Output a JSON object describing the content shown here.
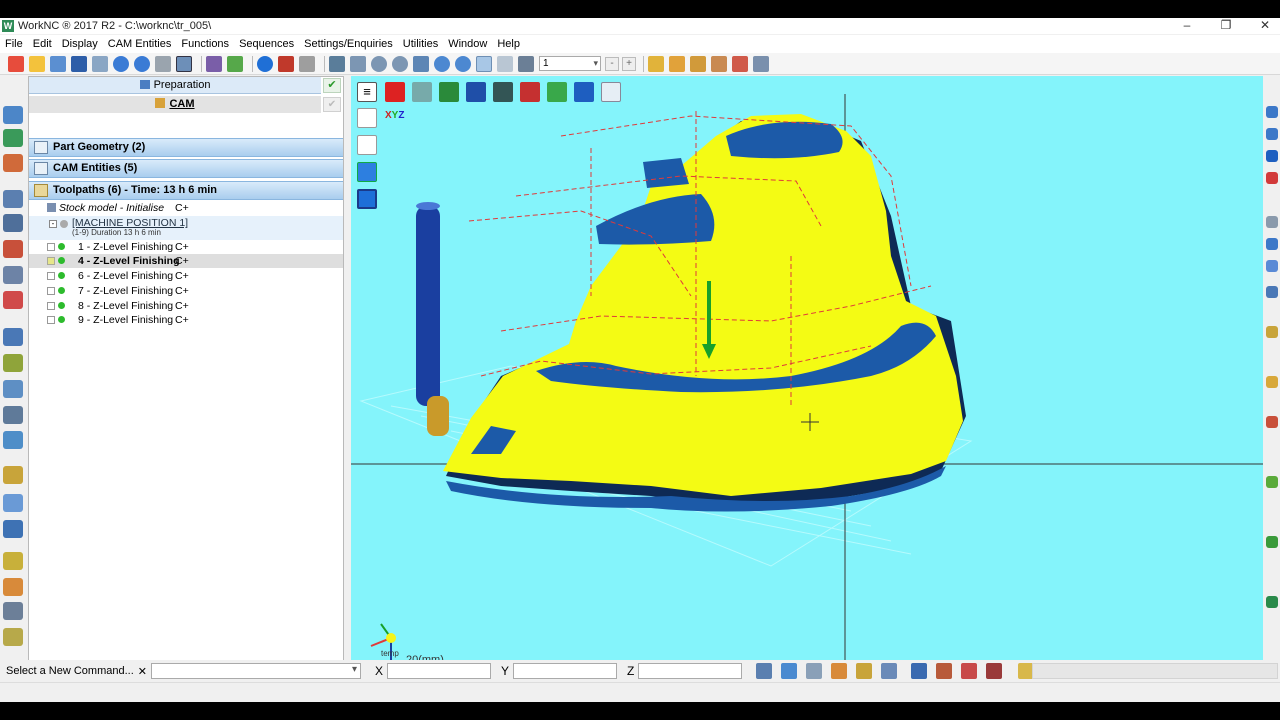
{
  "window": {
    "title": "WorkNC ® 2017 R2 - C:\\worknc\\tr_005\\",
    "logo_letter": "W",
    "minimize": "–",
    "restore": "❐",
    "close": "✕"
  },
  "menu": [
    "File",
    "Edit",
    "Display",
    "CAM Entities",
    "Functions",
    "Sequences",
    "Settings/Enquiries",
    "Utilities",
    "Window",
    "Help"
  ],
  "toolbar": {
    "level_select_value": "1",
    "minus_btn": "-",
    "plus_btn": "+"
  },
  "panel": {
    "preparation_tab": "Preparation",
    "cam_tab": "CAM",
    "check_icon": "✔",
    "sections": {
      "part_geometry": "Part Geometry (2)",
      "cam_entities": "CAM Entities (5)",
      "toolpaths": "Toolpaths (6) - Time: 13 h 6 min"
    },
    "stock_model": {
      "label": "Stock model - Initialise",
      "suffix": "C+"
    },
    "machine_position": {
      "label": "[MACHINE POSITION 1]",
      "sub": "(1-9) Duration 13 h 6 min"
    },
    "toolpaths": [
      {
        "label": "1 - Z-Level Finishing",
        "suffix": "C+",
        "checked": false,
        "selected": false
      },
      {
        "label": "4 - Z-Level Finishing",
        "suffix": "C+",
        "checked": true,
        "selected": true
      },
      {
        "label": "6 - Z-Level Finishing",
        "suffix": "C+",
        "checked": false,
        "selected": false
      },
      {
        "label": "7 - Z-Level Finishing",
        "suffix": "C+",
        "checked": false,
        "selected": false
      },
      {
        "label": "8 - Z-Level Finishing",
        "suffix": "C+",
        "checked": false,
        "selected": false
      },
      {
        "label": "9 - Z-Level Finishing",
        "suffix": "C+",
        "checked": false,
        "selected": false
      }
    ]
  },
  "viewport": {
    "background": "#84f4fb",
    "scale_label": "20(mm)",
    "axis_label": "temp",
    "axis_x": "X",
    "axis_y": "Y",
    "axis_z": "Z",
    "colors": {
      "part_yellow": "#f4fb14",
      "part_blue": "#1c5aa8",
      "tool_blue": "#1a3fa0",
      "tool_gold": "#c99a2a",
      "toolpath_red": "#e03a3a",
      "normal_green": "#18a02a"
    }
  },
  "command_bar": {
    "prompt": "Select a New Command...",
    "close": "✕",
    "x_label": "X",
    "y_label": "Y",
    "z_label": "Z"
  }
}
